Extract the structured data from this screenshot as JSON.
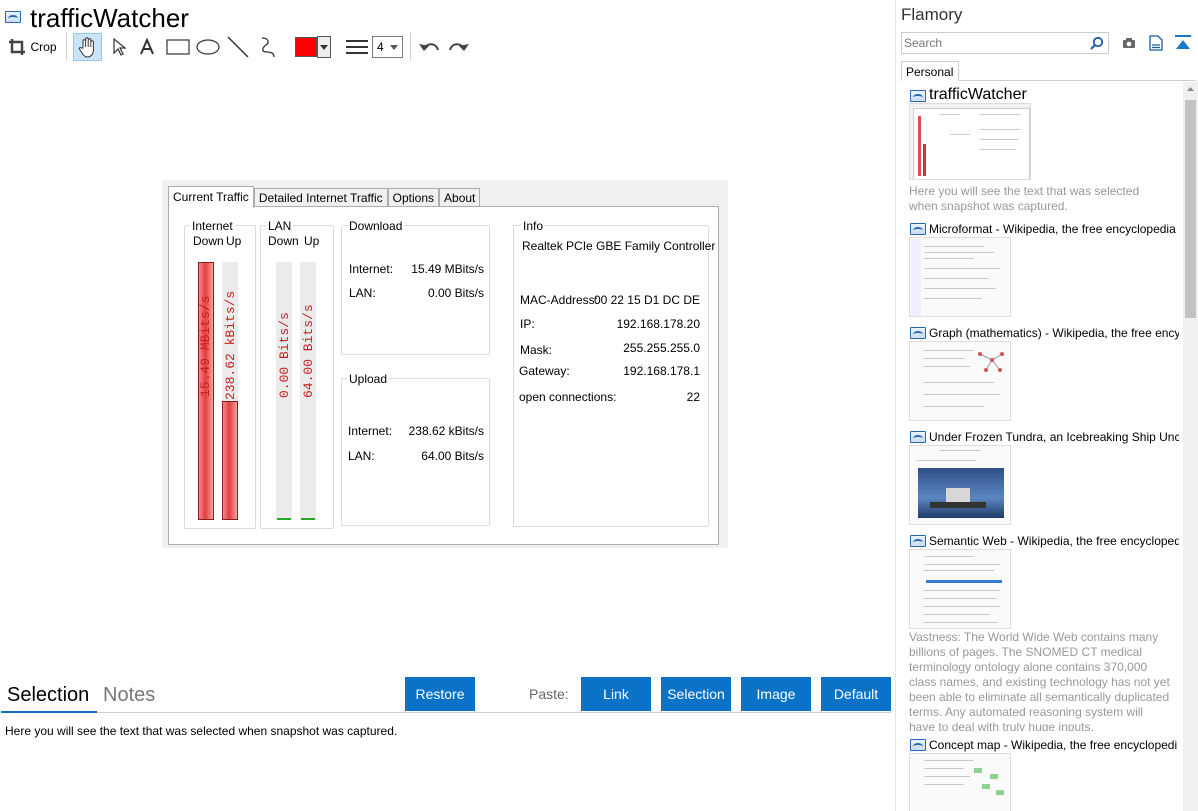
{
  "window": {
    "title": "trafficWatcher"
  },
  "toolbar": {
    "crop_label": "Crop",
    "line_width_value": "4",
    "color": "#ff0000"
  },
  "screenshot": {
    "tabs": [
      "Current Traffic",
      "Detailed Internet Traffic",
      "Options",
      "About"
    ],
    "internet": {
      "label": "Internet",
      "down": "Down",
      "up": "Up",
      "down_text": "15.49 MBits/s",
      "up_text": "238.62 kBits/s",
      "down_fill": 1.0,
      "up_fill": 0.46
    },
    "lan": {
      "label": "LAN",
      "down": "Down",
      "up": "Up",
      "down_text": "0.00 Bits/s",
      "up_text": "64.00 Bits/s"
    },
    "download": {
      "label": "Download",
      "internet_label": "Internet:",
      "internet_value": "15.49 MBits/s",
      "lan_label": "LAN:",
      "lan_value": "0.00 Bits/s"
    },
    "upload": {
      "label": "Upload",
      "internet_label": "Internet:",
      "internet_value": "238.62 kBits/s",
      "lan_label": "LAN:",
      "lan_value": "64.00 Bits/s"
    },
    "info": {
      "label": "Info",
      "adapter": "Realtek PCIe GBE Family Controller",
      "mac_label": "MAC-Address:",
      "mac_value": "00 22 15 D1 DC DE",
      "ip_label": "IP:",
      "ip_value": "192.168.178.20",
      "mask_label": "Mask:",
      "mask_value": "255.255.255.0",
      "gateway_label": "Gateway:",
      "gateway_value": "192.168.178.1",
      "conn_label": "open connections:",
      "conn_value": "22"
    }
  },
  "bottom": {
    "tabs": [
      "Selection",
      "Notes"
    ],
    "restore_label": "Restore",
    "paste_label": "Paste:",
    "paste_buttons": [
      "Link",
      "Selection",
      "Image",
      "Default"
    ],
    "selection_text": "Here you will see the text that was selected when snapshot was captured."
  },
  "sidebar": {
    "title": "Flamory",
    "search_placeholder": "Search",
    "tab": "Personal",
    "first_title": "trafficWatcher",
    "first_desc": "Here you will see the text that was selected when snapshot was captured.",
    "items": [
      {
        "title": "Microformat - Wikipedia, the free encyclopedia"
      },
      {
        "title": "Graph (mathematics) - Wikipedia, the free ency"
      },
      {
        "title": "Under Frozen Tundra, an Icebreaking Ship Unco"
      },
      {
        "title": "Semantic Web - Wikipedia, the free encycloped"
      },
      {
        "title": "Concept map - Wikipedia, the free encyclopedi"
      }
    ],
    "semantic_desc": "Vastness: The World Wide Web contains many billions of pages. The SNOMED CT medical terminology ontology alone contains 370,000 class names, and existing technology has not yet been able to eliminate all semantically duplicated terms. Any automated reasoning system will have to deal with truly huge inputs."
  }
}
